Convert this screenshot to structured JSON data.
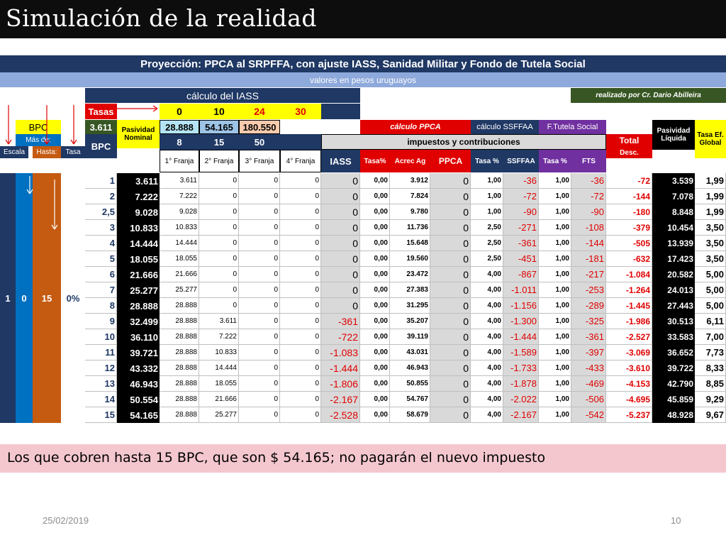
{
  "slide": {
    "title": "Simulación de la realidad",
    "date": "25/02/2019",
    "page": "10"
  },
  "header": {
    "title": "Proyección: PPCA al SRPFFA, con ajuste IASS, Sanidad Militar y Fondo de Tutela Social",
    "subtitle": "valores en pesos uruguayos",
    "calc_iass": "cálculo del IASS",
    "author": "realizado por Cr. Dario Abilleira"
  },
  "labels": {
    "tasas": "Tasas",
    "bpc": "BPC",
    "bpc_value": "3.611",
    "pasividad_nominal": "Pasividad Nominal",
    "mas_de": "Más de:",
    "escala": "Escala",
    "hasta": "Hasta:",
    "tasa": "Tasa",
    "calc_ppca": "cálculo PPCA",
    "calc_ssffaa": "cálculo SSFFAA",
    "tutela": "F.Tutela Social",
    "impuestos": "impuestos y contribuciones",
    "total": "Total",
    "desc": "Desc.",
    "pasividad_liquida": "Pasividad Líquida",
    "tasa_ef": "Tasa Ef. Global",
    "iass": "IASS",
    "tasa_pct": "Tasa%",
    "acrec": "Acrec Ag",
    "ppca": "PPCA",
    "tasa_pct2": "Tasa %",
    "ssffaa": "SSFFAA",
    "tasa_pct3": "Tasa %",
    "fts": "FTS"
  },
  "tasas": [
    "0",
    "10",
    "24",
    "30"
  ],
  "limits": [
    "28.888",
    "54.165",
    "180.550"
  ],
  "bpc_limits": [
    "8",
    "15",
    "50"
  ],
  "franjas": [
    "1° Franja",
    "2° Franja",
    "3° Franja",
    "4° Franja"
  ],
  "escala": {
    "escala": "1",
    "mas_de": "0",
    "hasta": "15",
    "tasa": "0%"
  },
  "rows": [
    [
      "1",
      "3.611",
      "3.611",
      "0",
      "0",
      "0",
      "0",
      "0,00",
      "3.912",
      "0",
      "1,00",
      "-36",
      "1,00",
      "-36",
      "-72",
      "3.539",
      "1,99"
    ],
    [
      "2",
      "7.222",
      "7.222",
      "0",
      "0",
      "0",
      "0",
      "0,00",
      "7.824",
      "0",
      "1,00",
      "-72",
      "1,00",
      "-72",
      "-144",
      "7.078",
      "1,99"
    ],
    [
      "2,5",
      "9.028",
      "9.028",
      "0",
      "0",
      "0",
      "0",
      "0,00",
      "9.780",
      "0",
      "1,00",
      "-90",
      "1,00",
      "-90",
      "-180",
      "8.848",
      "1,99"
    ],
    [
      "3",
      "10.833",
      "10.833",
      "0",
      "0",
      "0",
      "0",
      "0,00",
      "11.736",
      "0",
      "2,50",
      "-271",
      "1,00",
      "-108",
      "-379",
      "10.454",
      "3,50"
    ],
    [
      "4",
      "14.444",
      "14.444",
      "0",
      "0",
      "0",
      "0",
      "0,00",
      "15.648",
      "0",
      "2,50",
      "-361",
      "1,00",
      "-144",
      "-505",
      "13.939",
      "3,50"
    ],
    [
      "5",
      "18.055",
      "18.055",
      "0",
      "0",
      "0",
      "0",
      "0,00",
      "19.560",
      "0",
      "2,50",
      "-451",
      "1,00",
      "-181",
      "-632",
      "17.423",
      "3,50"
    ],
    [
      "6",
      "21.666",
      "21.666",
      "0",
      "0",
      "0",
      "0",
      "0,00",
      "23.472",
      "0",
      "4,00",
      "-867",
      "1,00",
      "-217",
      "-1.084",
      "20.582",
      "5,00"
    ],
    [
      "7",
      "25.277",
      "25.277",
      "0",
      "0",
      "0",
      "0",
      "0,00",
      "27.383",
      "0",
      "4,00",
      "-1.011",
      "1,00",
      "-253",
      "-1.264",
      "24.013",
      "5,00"
    ],
    [
      "8",
      "28.888",
      "28.888",
      "0",
      "0",
      "0",
      "0",
      "0,00",
      "31.295",
      "0",
      "4,00",
      "-1.156",
      "1,00",
      "-289",
      "-1.445",
      "27.443",
      "5,00"
    ],
    [
      "9",
      "32.499",
      "28.888",
      "3.611",
      "0",
      "0",
      "-361",
      "0,00",
      "35.207",
      "0",
      "4,00",
      "-1.300",
      "1,00",
      "-325",
      "-1.986",
      "30.513",
      "6,11"
    ],
    [
      "10",
      "36.110",
      "28.888",
      "7.222",
      "0",
      "0",
      "-722",
      "0,00",
      "39.119",
      "0",
      "4,00",
      "-1.444",
      "1,00",
      "-361",
      "-2.527",
      "33.583",
      "7,00"
    ],
    [
      "11",
      "39.721",
      "28.888",
      "10.833",
      "0",
      "0",
      "-1.083",
      "0,00",
      "43.031",
      "0",
      "4,00",
      "-1.589",
      "1,00",
      "-397",
      "-3.069",
      "36.652",
      "7,73"
    ],
    [
      "12",
      "43.332",
      "28.888",
      "14.444",
      "0",
      "0",
      "-1.444",
      "0,00",
      "46.943",
      "0",
      "4,00",
      "-1.733",
      "1,00",
      "-433",
      "-3.610",
      "39.722",
      "8,33"
    ],
    [
      "13",
      "46.943",
      "28.888",
      "18.055",
      "0",
      "0",
      "-1.806",
      "0,00",
      "50.855",
      "0",
      "4,00",
      "-1.878",
      "1,00",
      "-469",
      "-4.153",
      "42.790",
      "8,85"
    ],
    [
      "14",
      "50.554",
      "28.888",
      "21.666",
      "0",
      "0",
      "-2.167",
      "0,00",
      "54.767",
      "0",
      "4,00",
      "-2.022",
      "1,00",
      "-506",
      "-4.695",
      "45.859",
      "9,29"
    ],
    [
      "15",
      "54.165",
      "28.888",
      "25.277",
      "0",
      "0",
      "-2.528",
      "0,00",
      "58.679",
      "0",
      "4,00",
      "-2.167",
      "1,00",
      "-542",
      "-5.237",
      "48.928",
      "9,67"
    ]
  ],
  "note": "Los que cobren hasta 15 BPC, que son $ 54.165; no pagarán el nuevo impuesto"
}
